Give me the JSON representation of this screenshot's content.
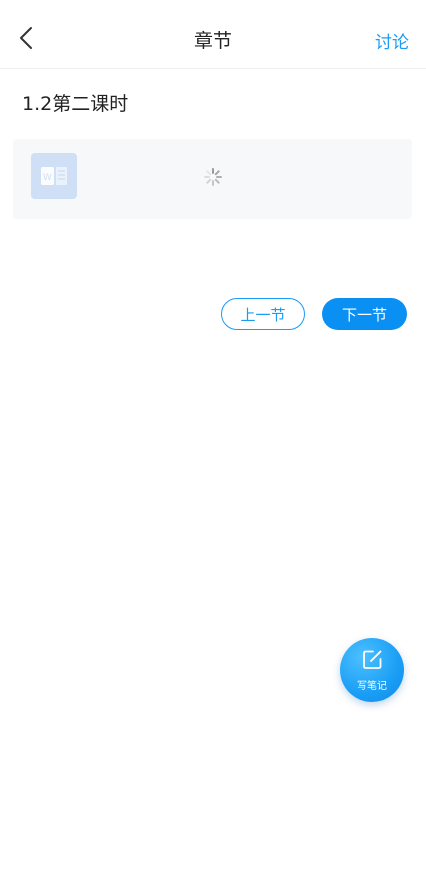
{
  "header": {
    "back_icon": "chevron-left-icon",
    "title": "章节",
    "discuss_label": "讨论"
  },
  "section": {
    "title": "1.2第二课时"
  },
  "attachment": {
    "type_icon": "word-document-icon",
    "loading_icon": "loading-spinner-icon"
  },
  "navigation": {
    "prev_label": "上一节",
    "next_label": "下一节"
  },
  "note_button": {
    "icon": "edit-note-icon",
    "label": "写笔记"
  },
  "colors": {
    "accent": "#1a9bf5",
    "next_button": "#0a8ff2",
    "card_background": "#f7f8f9",
    "word_icon": "#cfe0f6"
  }
}
